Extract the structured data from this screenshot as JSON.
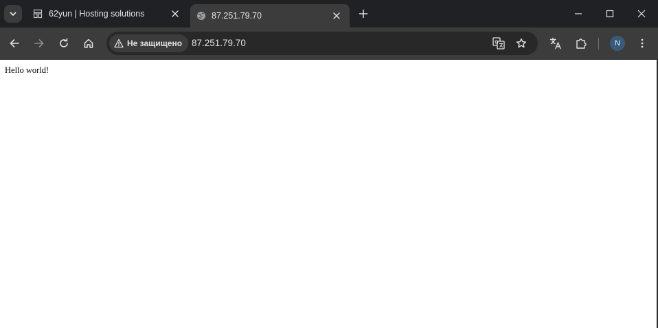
{
  "browser": {
    "tabs": [
      {
        "title": "62yun | Hosting solutions",
        "icon": "server-favicon-icon",
        "active": false
      },
      {
        "title": "87.251.79.70",
        "icon": "globe-icon",
        "active": true
      }
    ],
    "omnibox": {
      "security_label": "Не защищено",
      "url": "87.251.79.70"
    },
    "profile_initial": "N"
  },
  "page": {
    "body_text": "Hello world!"
  },
  "colors": {
    "tabstrip_bg": "#202124",
    "toolbar_bg": "#3c3c3c",
    "omnibox_bg": "#282828",
    "text_light": "#e3e3e3",
    "avatar_bg": "#3a5a7a"
  }
}
